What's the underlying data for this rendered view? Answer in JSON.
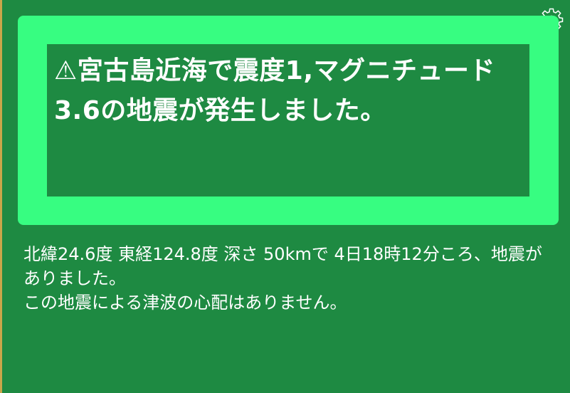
{
  "alert": {
    "title": "⚠宮古島近海で震度1,マグニチュード3.6の地震が発生しました。"
  },
  "details": {
    "line1": "北緯24.6度 東経124.8度 深さ 50kmで 4日18時12分ころ、地震がありました。",
    "line2": "この地震による津波の心配はありません。"
  },
  "icons": {
    "settings": "gear-icon"
  },
  "colors": {
    "background": "#1e8a42",
    "alert_frame": "#37fd81",
    "text": "#ffffff"
  }
}
